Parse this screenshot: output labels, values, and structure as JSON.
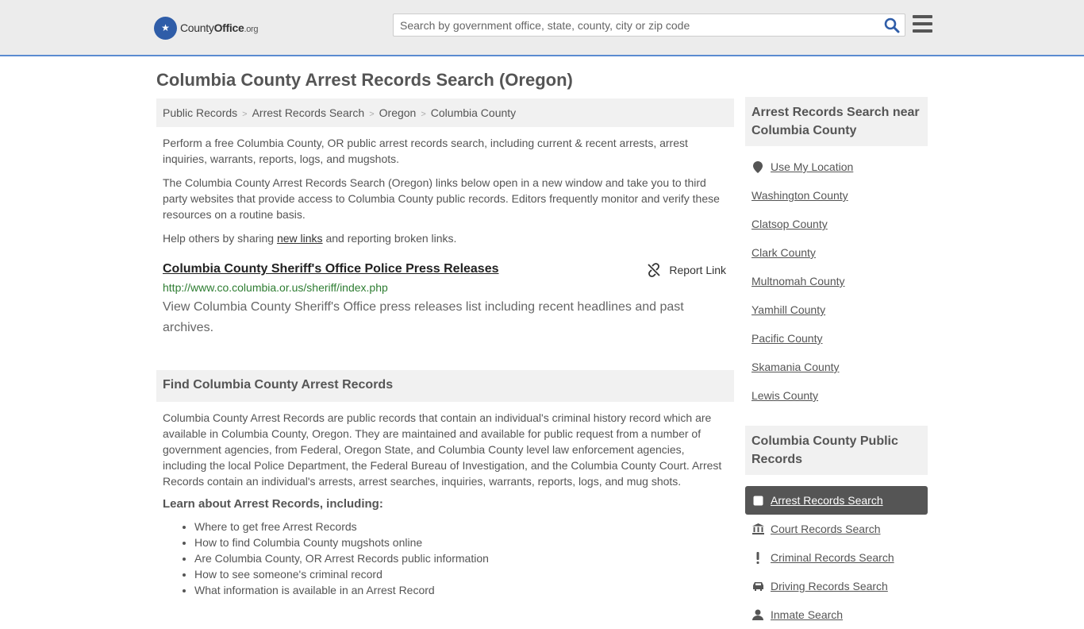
{
  "header": {
    "logo_brand": "County",
    "logo_brand_bold": "Office",
    "logo_tld": ".org",
    "search_placeholder": "Search by government office, state, county, city or zip code"
  },
  "page_title": "Columbia County Arrest Records Search (Oregon)",
  "breadcrumb": [
    "Public Records",
    "Arrest Records Search",
    "Oregon",
    "Columbia County"
  ],
  "intro": {
    "p1": "Perform a free Columbia County, OR public arrest records search, including current & recent arrests, arrest inquiries, warrants, reports, logs, and mugshots.",
    "p2": "The Columbia County Arrest Records Search (Oregon) links below open in a new window and take you to third party websites that provide access to Columbia County public records. Editors frequently monitor and verify these resources on a routine basis.",
    "p3_before": "Help others by sharing ",
    "p3_link": "new links",
    "p3_after": " and reporting broken links."
  },
  "link_card": {
    "title": "Columbia County Sheriff's Office Police Press Releases",
    "report_label": "Report Link",
    "url": "http://www.co.columbia.or.us/sheriff/index.php",
    "description": "View Columbia County Sheriff's Office press releases list including recent headlines and past archives."
  },
  "find_section": {
    "heading": "Find Columbia County Arrest Records",
    "body": "Columbia County Arrest Records are public records that contain an individual's criminal history record which are available in Columbia County, Oregon. They are maintained and available for public request from a number of government agencies, from Federal, Oregon State, and Columbia County level law enforcement agencies, including the local Police Department, the Federal Bureau of Investigation, and the Columbia County Court. Arrest Records contain an individual's arrests, arrest searches, inquiries, warrants, reports, logs, and mug shots.",
    "learn_heading": "Learn about Arrest Records, including:",
    "learn_items": [
      "Where to get free Arrest Records",
      "How to find Columbia County mugshots online",
      "Are Columbia County, OR Arrest Records public information",
      "How to see someone's criminal record",
      "What information is available in an Arrest Record"
    ]
  },
  "sidebar": {
    "near_heading": "Arrest Records Search near Columbia County",
    "use_location": "Use My Location",
    "near_items": [
      "Washington County",
      "Clatsop County",
      "Clark County",
      "Multnomah County",
      "Yamhill County",
      "Pacific County",
      "Skamania County",
      "Lewis County"
    ],
    "public_heading": "Columbia County Public Records",
    "public_items": [
      {
        "label": "Arrest Records Search",
        "icon": "square-icon",
        "active": true
      },
      {
        "label": "Court Records Search",
        "icon": "courthouse-icon",
        "active": false
      },
      {
        "label": "Criminal Records Search",
        "icon": "exclamation-icon",
        "active": false
      },
      {
        "label": "Driving Records Search",
        "icon": "car-icon",
        "active": false
      },
      {
        "label": "Inmate Search",
        "icon": "inmate-icon",
        "active": false
      }
    ]
  },
  "colors": {
    "header_bg": "#ececec",
    "header_border": "#5b8bd1",
    "url_green": "#2e7d32",
    "active_bg": "#555555"
  }
}
